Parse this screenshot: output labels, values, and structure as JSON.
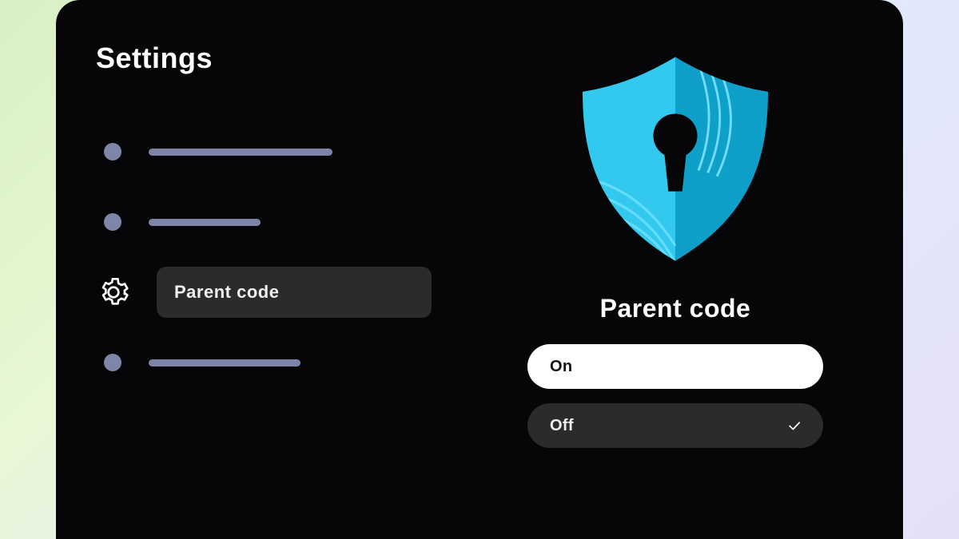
{
  "title": "Settings",
  "menu": {
    "active_label": "Parent code",
    "active_icon": "gear-icon"
  },
  "detail": {
    "title": "Parent code",
    "options": {
      "on_label": "On",
      "off_label": "Off",
      "selected": "off"
    }
  },
  "colors": {
    "panel_bg": "#060608",
    "placeholder": "#7d86a9",
    "active_bg": "#2b2b2e",
    "shield_light": "#33c8ee",
    "shield_dark": "#0ea0c8"
  }
}
